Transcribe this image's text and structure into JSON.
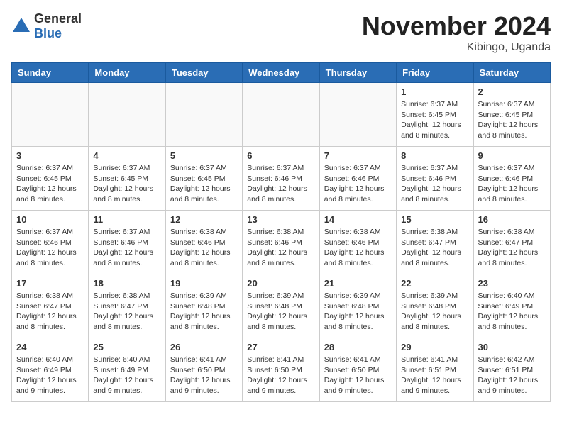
{
  "logo": {
    "general": "General",
    "blue": "Blue"
  },
  "header": {
    "month_year": "November 2024",
    "location": "Kibingo, Uganda"
  },
  "weekdays": [
    "Sunday",
    "Monday",
    "Tuesday",
    "Wednesday",
    "Thursday",
    "Friday",
    "Saturday"
  ],
  "weeks": [
    [
      {
        "day": "",
        "info": ""
      },
      {
        "day": "",
        "info": ""
      },
      {
        "day": "",
        "info": ""
      },
      {
        "day": "",
        "info": ""
      },
      {
        "day": "",
        "info": ""
      },
      {
        "day": "1",
        "info": "Sunrise: 6:37 AM\nSunset: 6:45 PM\nDaylight: 12 hours and 8 minutes."
      },
      {
        "day": "2",
        "info": "Sunrise: 6:37 AM\nSunset: 6:45 PM\nDaylight: 12 hours and 8 minutes."
      }
    ],
    [
      {
        "day": "3",
        "info": "Sunrise: 6:37 AM\nSunset: 6:45 PM\nDaylight: 12 hours and 8 minutes."
      },
      {
        "day": "4",
        "info": "Sunrise: 6:37 AM\nSunset: 6:45 PM\nDaylight: 12 hours and 8 minutes."
      },
      {
        "day": "5",
        "info": "Sunrise: 6:37 AM\nSunset: 6:45 PM\nDaylight: 12 hours and 8 minutes."
      },
      {
        "day": "6",
        "info": "Sunrise: 6:37 AM\nSunset: 6:46 PM\nDaylight: 12 hours and 8 minutes."
      },
      {
        "day": "7",
        "info": "Sunrise: 6:37 AM\nSunset: 6:46 PM\nDaylight: 12 hours and 8 minutes."
      },
      {
        "day": "8",
        "info": "Sunrise: 6:37 AM\nSunset: 6:46 PM\nDaylight: 12 hours and 8 minutes."
      },
      {
        "day": "9",
        "info": "Sunrise: 6:37 AM\nSunset: 6:46 PM\nDaylight: 12 hours and 8 minutes."
      }
    ],
    [
      {
        "day": "10",
        "info": "Sunrise: 6:37 AM\nSunset: 6:46 PM\nDaylight: 12 hours and 8 minutes."
      },
      {
        "day": "11",
        "info": "Sunrise: 6:37 AM\nSunset: 6:46 PM\nDaylight: 12 hours and 8 minutes."
      },
      {
        "day": "12",
        "info": "Sunrise: 6:38 AM\nSunset: 6:46 PM\nDaylight: 12 hours and 8 minutes."
      },
      {
        "day": "13",
        "info": "Sunrise: 6:38 AM\nSunset: 6:46 PM\nDaylight: 12 hours and 8 minutes."
      },
      {
        "day": "14",
        "info": "Sunrise: 6:38 AM\nSunset: 6:46 PM\nDaylight: 12 hours and 8 minutes."
      },
      {
        "day": "15",
        "info": "Sunrise: 6:38 AM\nSunset: 6:47 PM\nDaylight: 12 hours and 8 minutes."
      },
      {
        "day": "16",
        "info": "Sunrise: 6:38 AM\nSunset: 6:47 PM\nDaylight: 12 hours and 8 minutes."
      }
    ],
    [
      {
        "day": "17",
        "info": "Sunrise: 6:38 AM\nSunset: 6:47 PM\nDaylight: 12 hours and 8 minutes."
      },
      {
        "day": "18",
        "info": "Sunrise: 6:38 AM\nSunset: 6:47 PM\nDaylight: 12 hours and 8 minutes."
      },
      {
        "day": "19",
        "info": "Sunrise: 6:39 AM\nSunset: 6:48 PM\nDaylight: 12 hours and 8 minutes."
      },
      {
        "day": "20",
        "info": "Sunrise: 6:39 AM\nSunset: 6:48 PM\nDaylight: 12 hours and 8 minutes."
      },
      {
        "day": "21",
        "info": "Sunrise: 6:39 AM\nSunset: 6:48 PM\nDaylight: 12 hours and 8 minutes."
      },
      {
        "day": "22",
        "info": "Sunrise: 6:39 AM\nSunset: 6:48 PM\nDaylight: 12 hours and 8 minutes."
      },
      {
        "day": "23",
        "info": "Sunrise: 6:40 AM\nSunset: 6:49 PM\nDaylight: 12 hours and 8 minutes."
      }
    ],
    [
      {
        "day": "24",
        "info": "Sunrise: 6:40 AM\nSunset: 6:49 PM\nDaylight: 12 hours and 9 minutes."
      },
      {
        "day": "25",
        "info": "Sunrise: 6:40 AM\nSunset: 6:49 PM\nDaylight: 12 hours and 9 minutes."
      },
      {
        "day": "26",
        "info": "Sunrise: 6:41 AM\nSunset: 6:50 PM\nDaylight: 12 hours and 9 minutes."
      },
      {
        "day": "27",
        "info": "Sunrise: 6:41 AM\nSunset: 6:50 PM\nDaylight: 12 hours and 9 minutes."
      },
      {
        "day": "28",
        "info": "Sunrise: 6:41 AM\nSunset: 6:50 PM\nDaylight: 12 hours and 9 minutes."
      },
      {
        "day": "29",
        "info": "Sunrise: 6:41 AM\nSunset: 6:51 PM\nDaylight: 12 hours and 9 minutes."
      },
      {
        "day": "30",
        "info": "Sunrise: 6:42 AM\nSunset: 6:51 PM\nDaylight: 12 hours and 9 minutes."
      }
    ]
  ]
}
